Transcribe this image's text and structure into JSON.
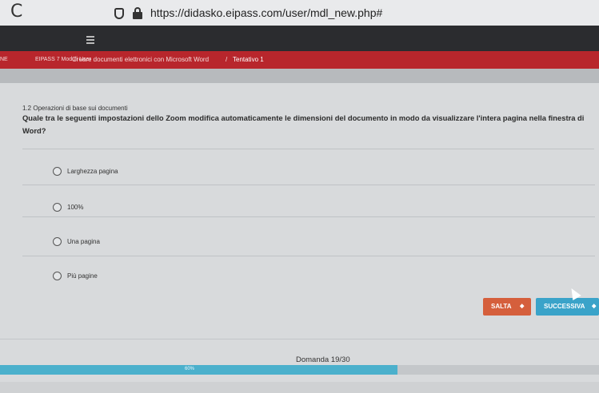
{
  "browser": {
    "reload_glyph": "C",
    "url": "https://didasko.eipass.com/user/mdl_new.php#"
  },
  "breadcrumb": {
    "items": [
      "NE",
      "EIPASS 7 Moduli User",
      "Creare documenti elettronici con Microsoft Word",
      "Tentativo 1"
    ]
  },
  "quiz": {
    "section_title": "1.2 Operazioni di base sui documenti",
    "question": "Quale tra le seguenti impostazioni dello Zoom modifica automaticamente le dimensioni del documento in modo da visualizzare l'intera pagina nella finestra di Word?",
    "options": [
      "Larghezza pagina",
      "100%",
      "Una pagina",
      "Più pagine"
    ],
    "skip_label": "SALTA",
    "next_label": "SUCCESSIVA",
    "counter": "Domanda 19/30",
    "progress_label": "60%",
    "progress_fraction": 0.6633
  },
  "colors": {
    "breadcrumb_bg": "#b8262c",
    "skip_button": "#d55f3c",
    "next_button": "#3aa3c9",
    "progress_fill": "#4bb0cc"
  },
  "icons": {
    "reload": "reload-icon",
    "shield": "shield-icon",
    "lock": "lock-icon",
    "menu": "hamburger-menu-icon",
    "arrow": "arrow-right-icon"
  }
}
